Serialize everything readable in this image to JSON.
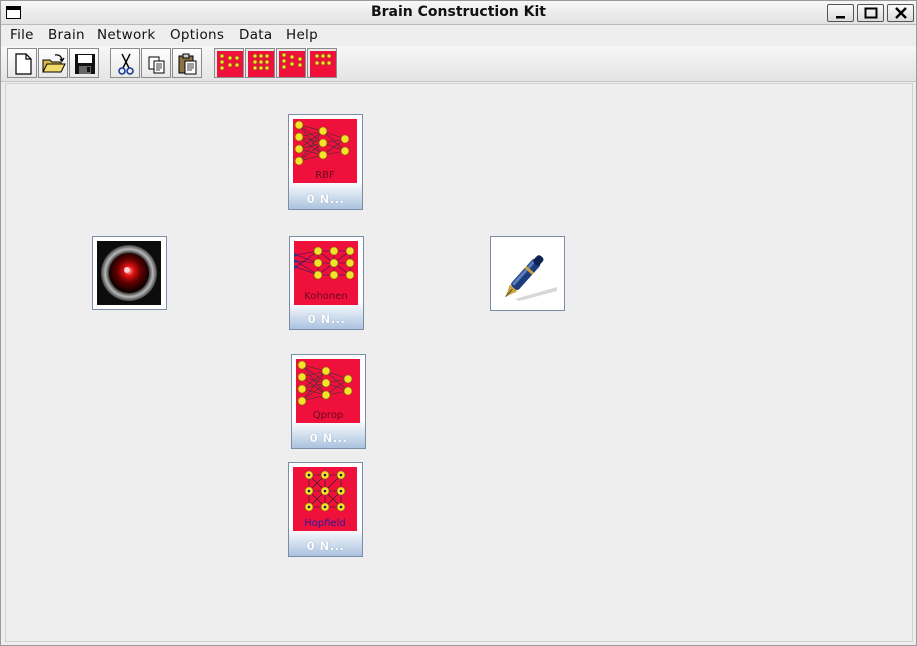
{
  "window": {
    "title": "Brain Construction Kit"
  },
  "menu": [
    "File",
    "Brain",
    "Network",
    "Options",
    "Data",
    "Help"
  ],
  "toolbar": {
    "buttons": [
      "new-file",
      "open-folder",
      "save-disk",
      "cut-scissors",
      "copy",
      "paste"
    ],
    "network_buttons": [
      "rbf-network",
      "kohonen-network",
      "qprop-network",
      "hopfield-network"
    ]
  },
  "nodes": {
    "rbf": {
      "label": "RBF",
      "caption": "0 N..."
    },
    "kohonen": {
      "label": "Kohonen",
      "caption": "0 N..."
    },
    "qprop": {
      "label": "Qprop",
      "caption": "0 N..."
    },
    "hopfield": {
      "label": "Hopfield",
      "caption": "0 N..."
    }
  },
  "colors": {
    "network_bg": "#f0103c",
    "neuron": "#f5e22a",
    "caption_bg": "#aac3df"
  }
}
